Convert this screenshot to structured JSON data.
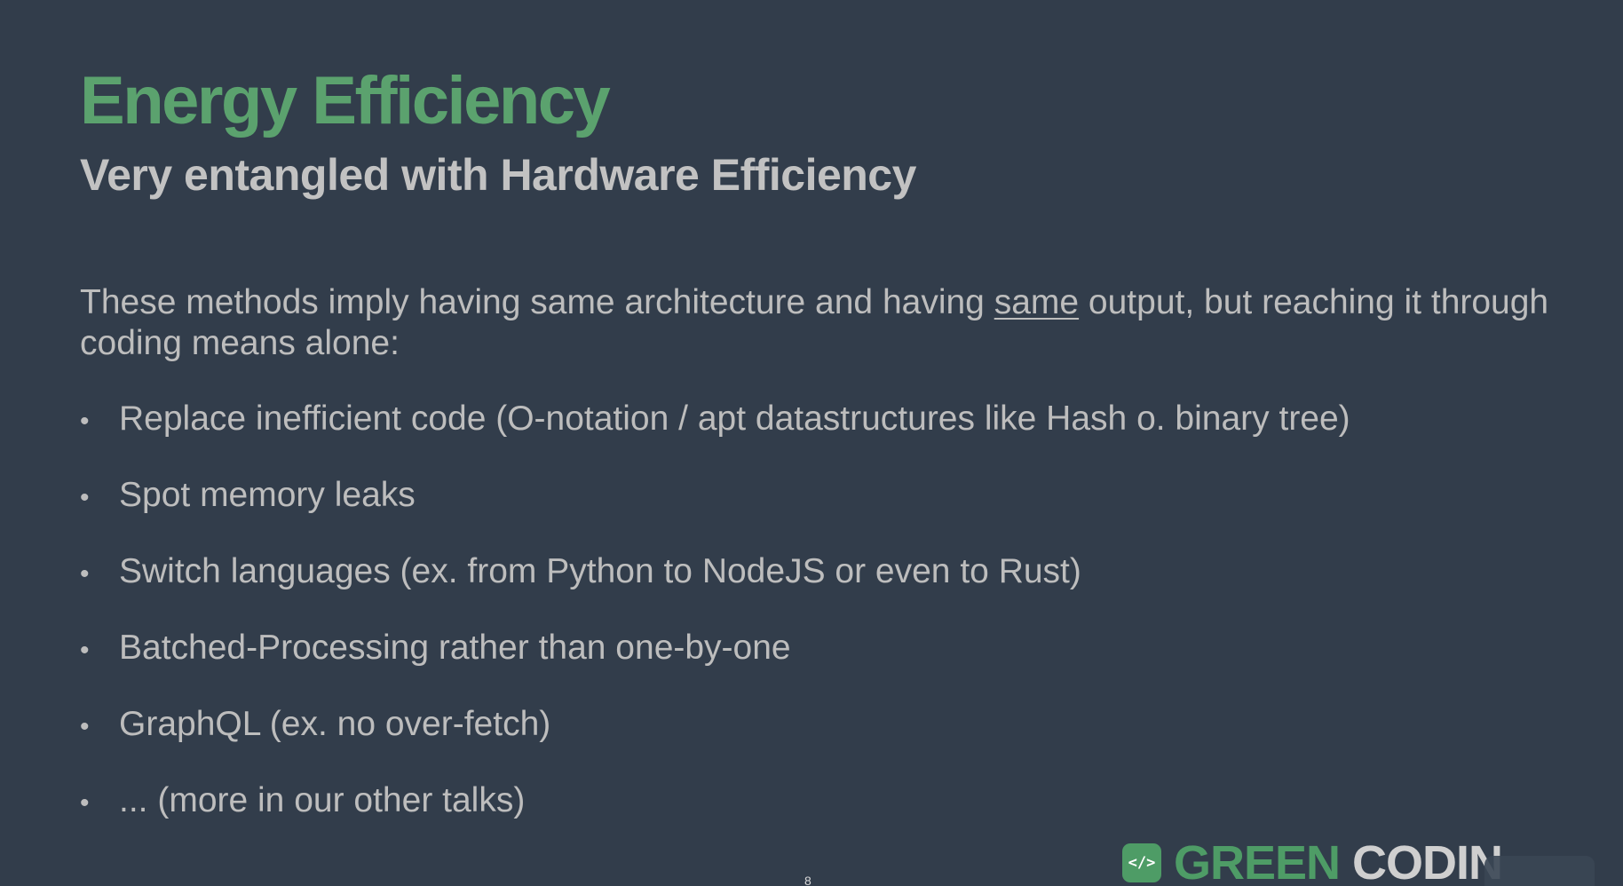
{
  "slide": {
    "title": "Energy Efficiency",
    "subtitle": "Very entangled with Hardware Efficiency",
    "intro": {
      "before": "These methods imply having same architecture and having ",
      "emphasis": "same",
      "after": " output, but reaching it through coding means alone:"
    },
    "bullets": [
      "Replace inefficient code (O-notation / apt datastructures like Hash o. binary tree)",
      "Spot memory leaks",
      "Switch languages (ex. from Python to NodeJS or even to Rust)",
      "Batched-Processing rather than one-by-one",
      "GraphQL (ex. no over-fetch)",
      "... (more in our other talks)"
    ],
    "bullet_glyph": "•",
    "page_number": "8"
  },
  "logo": {
    "mark": "</>",
    "word1": "GREEN",
    "word2": "CODIN"
  },
  "colors": {
    "background": "#323d4b",
    "title": "#5ba26e",
    "text": "#bdbdbd",
    "brand_green": "#4e9c66"
  }
}
